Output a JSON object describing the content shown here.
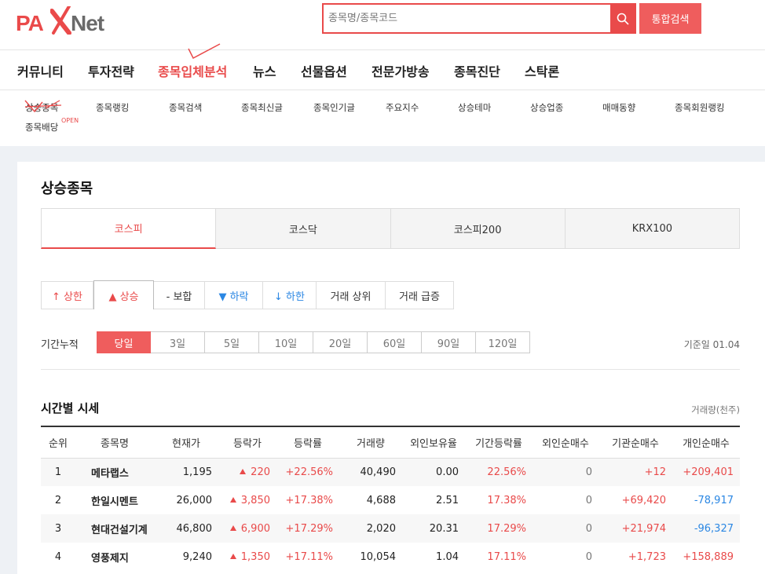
{
  "logo": {
    "text_left": "PA",
    "text_right": "Net"
  },
  "search": {
    "placeholder": "종목명/종목코드",
    "button_label": "통합검색"
  },
  "gnb": [
    "커뮤니티",
    "투자전략",
    "종목입체분석",
    "뉴스",
    "선물옵션",
    "전문가방송",
    "종목진단",
    "스탁론"
  ],
  "snb": [
    "상승종목",
    "종목랭킹",
    "종목검색",
    "종목최신글",
    "종목인기글",
    "주요지수",
    "상승테마",
    "상승업종",
    "매매동향",
    "종목회원랭킹",
    "종목배당"
  ],
  "snb_badge": "OPEN",
  "page_title": "상승종목",
  "market_tabs": [
    "코스피",
    "코스닥",
    "코스피200",
    "KRX100"
  ],
  "sub_tabs": [
    "↑ 상한",
    "▲ 상승",
    "- 보합",
    "▼ 하락",
    "↓ 하한",
    "거래 상위",
    "거래 급증"
  ],
  "period": {
    "label": "기간누적",
    "options": [
      "당일",
      "3일",
      "5일",
      "10일",
      "20일",
      "60일",
      "90일",
      "120일"
    ],
    "base_date": "기준일 01.04"
  },
  "section": {
    "title": "시간별 시세",
    "unit": "거래량(천주)"
  },
  "table": {
    "headers": [
      "순위",
      "종목명",
      "현재가",
      "등락가",
      "등락률",
      "거래량",
      "외인보유율",
      "기간등락률",
      "외인순매수",
      "기관순매수",
      "개인순매수"
    ],
    "rows": [
      [
        "1",
        "메타랩스",
        "1,195",
        "220",
        "+22.56%",
        "40,490",
        "0.00",
        "22.56%",
        "0",
        "+12",
        "+209,401"
      ],
      [
        "2",
        "한일시멘트",
        "26,000",
        "3,850",
        "+17.38%",
        "4,688",
        "2.51",
        "17.38%",
        "0",
        "+69,420",
        "-78,917"
      ],
      [
        "3",
        "현대건설기계",
        "46,800",
        "6,900",
        "+17.29%",
        "2,020",
        "20.31",
        "17.29%",
        "0",
        "+21,974",
        "-96,327"
      ],
      [
        "4",
        "영풍제지",
        "9,240",
        "1,350",
        "+17.11%",
        "10,054",
        "1.04",
        "17.11%",
        "0",
        "+1,723",
        "+158,889"
      ]
    ]
  },
  "colors": {
    "accent": "#e94a4a",
    "down": "#2b87e3"
  }
}
